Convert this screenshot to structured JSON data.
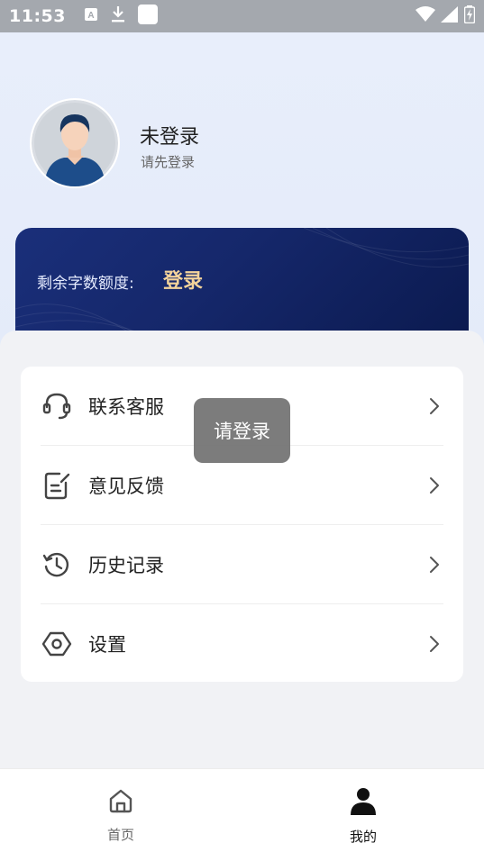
{
  "status_bar": {
    "time": "11:53",
    "icons": [
      "notification-a-icon",
      "download-icon",
      "square-icon",
      "wifi-icon",
      "signal-icon",
      "battery-icon"
    ]
  },
  "profile": {
    "name": "未登录",
    "subtitle": "请先登录"
  },
  "quota": {
    "label": "剩余字数额度:",
    "value": "登录",
    "value_color": "#f3d39b"
  },
  "menu": {
    "items": [
      {
        "label": "联系客服",
        "icon": "headset-icon"
      },
      {
        "label": "意见反馈",
        "icon": "feedback-icon"
      },
      {
        "label": "历史记录",
        "icon": "history-icon"
      },
      {
        "label": "设置",
        "icon": "settings-icon"
      }
    ]
  },
  "toast": {
    "text": "请登录"
  },
  "bottom_nav": {
    "items": [
      {
        "label": "首页",
        "icon": "home-icon",
        "active": false
      },
      {
        "label": "我的",
        "icon": "user-icon",
        "active": true
      }
    ]
  }
}
